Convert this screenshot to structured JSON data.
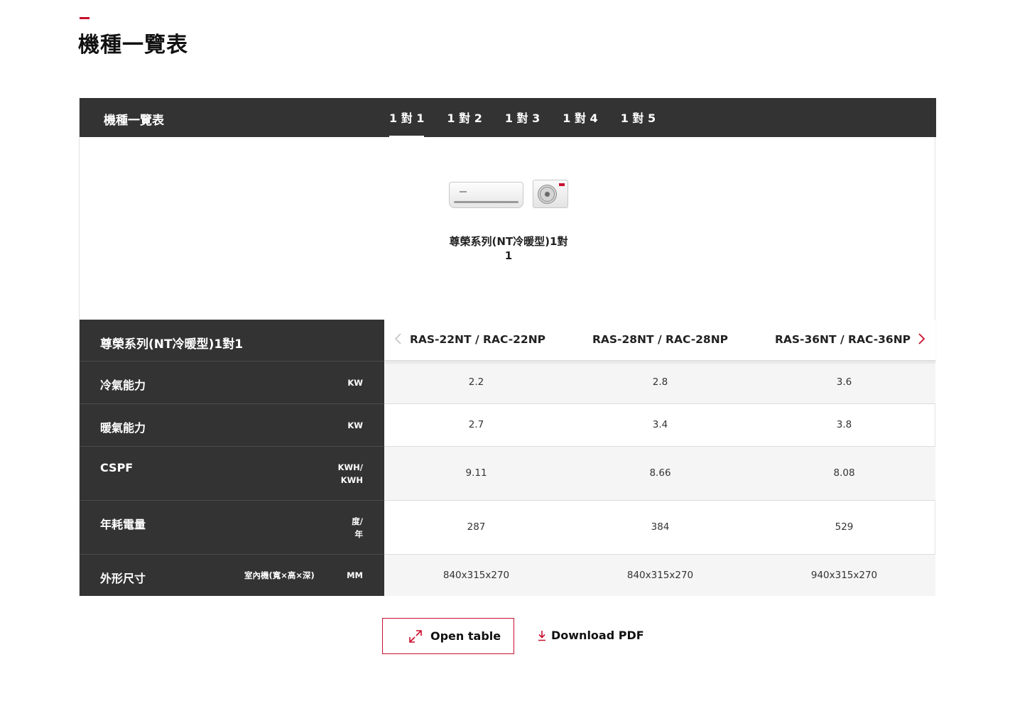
{
  "page": {
    "title": "機種一覽表"
  },
  "tabbar": {
    "title": "機種一覽表",
    "tabs": [
      {
        "label": "1 對 1",
        "active": true
      },
      {
        "label": "1 對 2",
        "active": false
      },
      {
        "label": "1 對 3",
        "active": false
      },
      {
        "label": "1 對 4",
        "active": false
      },
      {
        "label": "1 對 5",
        "active": false
      }
    ]
  },
  "product": {
    "name": "尊榮系列(NT冷暖型)1對1"
  },
  "spec_table": {
    "series_title": "尊榮系列(NT冷暖型)1對1",
    "models": [
      "RAS-22NT / RAC-22NP",
      "RAS-28NT / RAC-28NP",
      "RAS-36NT / RAC-36NP"
    ],
    "rows": [
      {
        "label": "冷氣能力",
        "sublabel": "",
        "unit": "KW",
        "values": [
          "2.2",
          "2.8",
          "3.6"
        ]
      },
      {
        "label": "暖氣能力",
        "sublabel": "",
        "unit": "KW",
        "values": [
          "2.7",
          "3.4",
          "3.8"
        ]
      },
      {
        "label": "CSPF",
        "sublabel": "",
        "unit": "KWH/\nKWH",
        "values": [
          "9.11",
          "8.66",
          "8.08"
        ]
      },
      {
        "label": "年耗電量",
        "sublabel": "",
        "unit": "度/\n年",
        "values": [
          "287",
          "384",
          "529"
        ]
      },
      {
        "label": "外形尺寸",
        "sublabel": "室內機(寬×高×深)",
        "unit": "MM",
        "values": [
          "840x315x270",
          "840x315x270",
          "940x315x270"
        ]
      }
    ],
    "nav": {
      "prev_icon": "chevron-left-icon",
      "next_icon": "chevron-right-icon"
    }
  },
  "actions": {
    "open_table": {
      "label": "Open table",
      "icon": "expand-icon"
    },
    "download_pdf": {
      "label": "Download PDF",
      "icon": "download-icon"
    }
  },
  "colors": {
    "accent": "#c8102e",
    "dark": "#333333",
    "row_shade": "#f5f5f5"
  }
}
